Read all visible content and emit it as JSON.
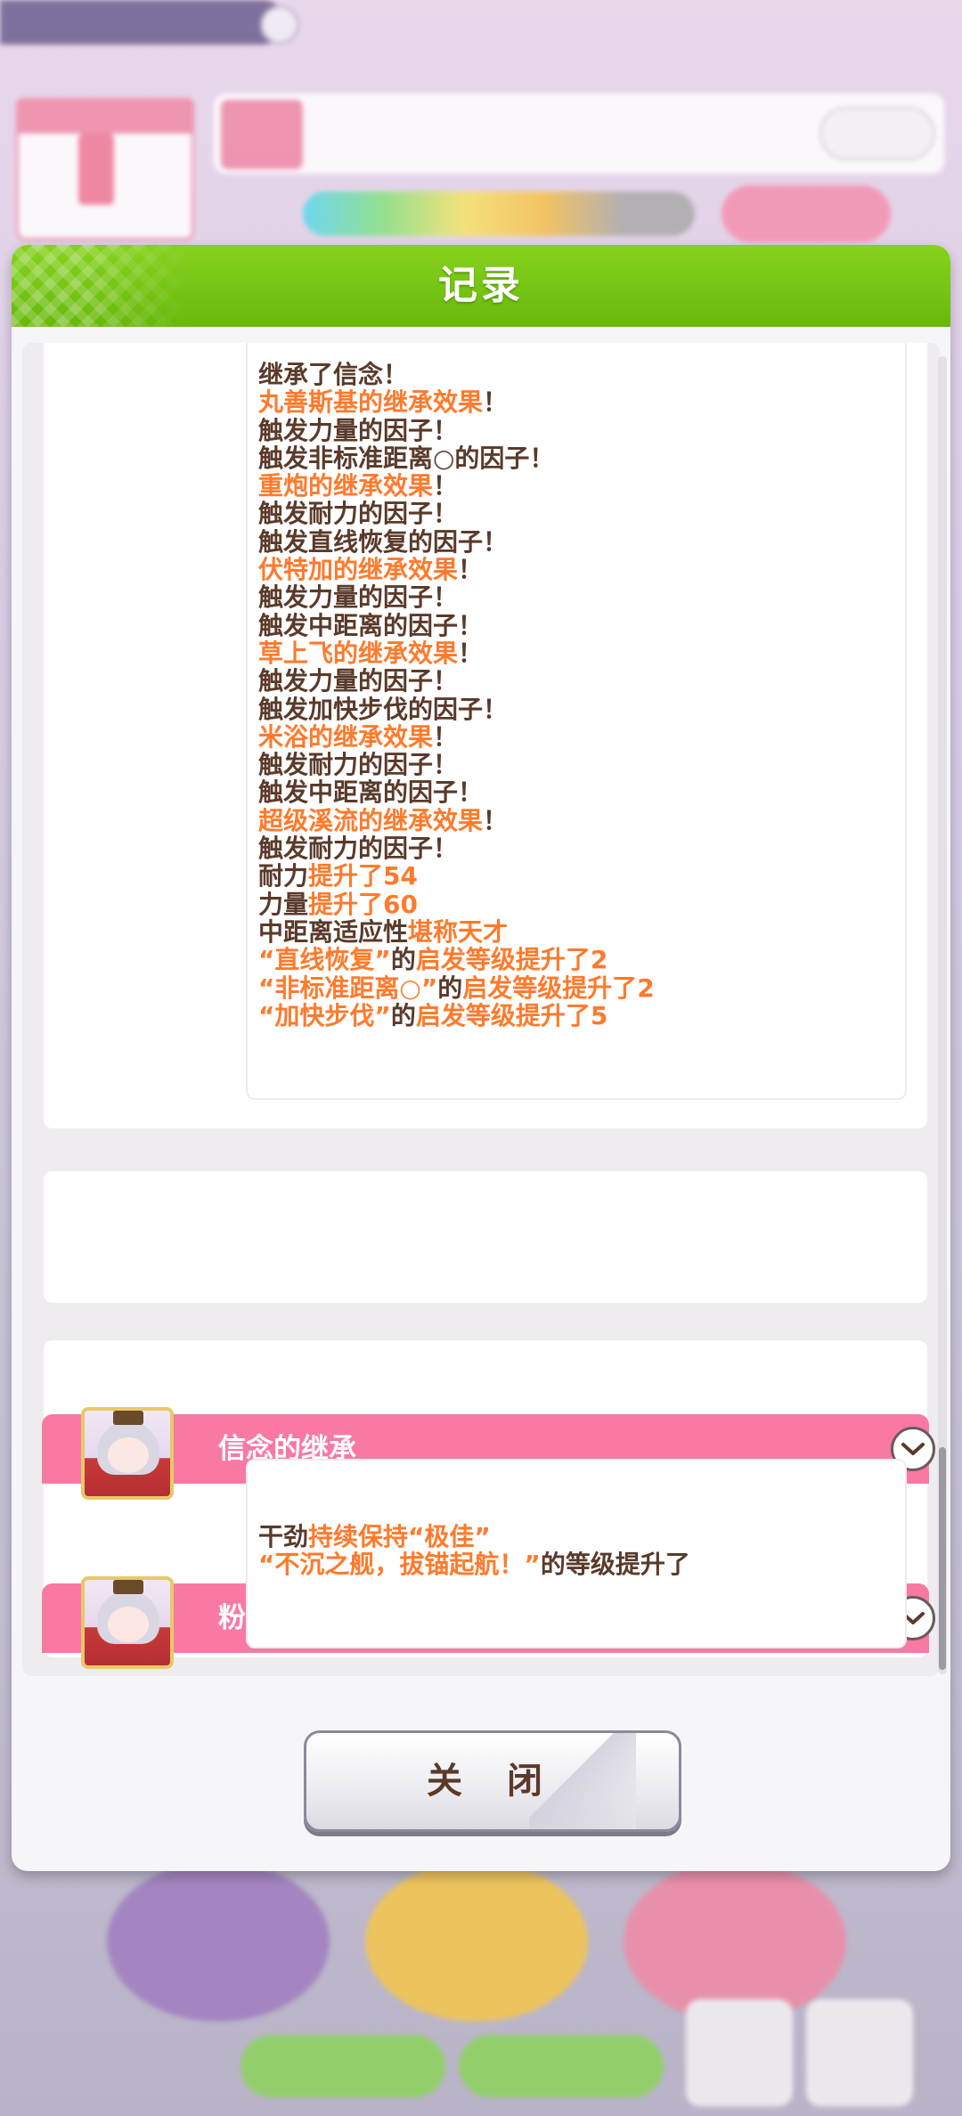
{
  "dialog": {
    "title": "记录",
    "close_label": "关 闭"
  },
  "log1": [
    [
      {
        "t": "继承了信念！",
        "c": "d"
      }
    ],
    [
      {
        "t": "丸善斯基的继承效果",
        "c": "o"
      },
      {
        "t": "！",
        "c": "d"
      }
    ],
    [
      {
        "t": "触发力量的因子！",
        "c": "d"
      }
    ],
    [
      {
        "t": "触发非标准距离○的因子！",
        "c": "d"
      }
    ],
    [
      {
        "t": "重炮的继承效果",
        "c": "o"
      },
      {
        "t": "！",
        "c": "d"
      }
    ],
    [
      {
        "t": "触发耐力的因子！",
        "c": "d"
      }
    ],
    [
      {
        "t": "触发直线恢复的因子！",
        "c": "d"
      }
    ],
    [
      {
        "t": "伏特加的继承效果",
        "c": "o"
      },
      {
        "t": "！",
        "c": "d"
      }
    ],
    [
      {
        "t": "触发力量的因子！",
        "c": "d"
      }
    ],
    [
      {
        "t": "触发中距离的因子！",
        "c": "d"
      }
    ],
    [
      {
        "t": "草上飞的继承效果",
        "c": "o"
      },
      {
        "t": "！",
        "c": "d"
      }
    ],
    [
      {
        "t": "触发力量的因子！",
        "c": "d"
      }
    ],
    [
      {
        "t": "触发加快步伐的因子！",
        "c": "d"
      }
    ],
    [
      {
        "t": "米浴的继承效果",
        "c": "o"
      },
      {
        "t": "！",
        "c": "d"
      }
    ],
    [
      {
        "t": "触发耐力的因子！",
        "c": "d"
      }
    ],
    [
      {
        "t": "触发中距离的因子！",
        "c": "d"
      }
    ],
    [
      {
        "t": "超级溪流的继承效果",
        "c": "o"
      },
      {
        "t": "！",
        "c": "d"
      }
    ],
    [
      {
        "t": "触发耐力的因子！",
        "c": "d"
      }
    ],
    [
      {
        "t": "耐力",
        "c": "d"
      },
      {
        "t": "提升了54",
        "c": "o"
      }
    ],
    [
      {
        "t": "力量",
        "c": "d"
      },
      {
        "t": "提升了60",
        "c": "o"
      }
    ],
    [
      {
        "t": "中距离适应性",
        "c": "d"
      },
      {
        "t": "堪称天才",
        "c": "o"
      }
    ],
    [
      {
        "t": "“直线恢复”",
        "c": "o"
      },
      {
        "t": "的",
        "c": "d"
      },
      {
        "t": "启发等级提升了2",
        "c": "o"
      }
    ],
    [
      {
        "t": "“非标准距离○”",
        "c": "o"
      },
      {
        "t": "的",
        "c": "d"
      },
      {
        "t": "启发等级提升了2",
        "c": "o"
      }
    ],
    [
      {
        "t": "“加快步伐”",
        "c": "o"
      },
      {
        "t": "的",
        "c": "d"
      },
      {
        "t": "启发等级提升了5",
        "c": "o"
      }
    ]
  ],
  "events": [
    {
      "title": "信念的继承"
    },
    {
      "title": "粉丝答谢会"
    }
  ],
  "log2": [
    [
      {
        "t": "干劲",
        "c": "d"
      },
      {
        "t": "持续保持“极佳”",
        "c": "o"
      }
    ],
    [
      {
        "t": "“不沉之舰，拔锚起航！”",
        "c": "o"
      },
      {
        "t": "的等级提升了",
        "c": "d"
      }
    ]
  ],
  "colors": {
    "header_green": "#78c816",
    "banner_pink": "#f879a2",
    "text_dark": "#5a3a2a",
    "text_orange": "#ff7a2c"
  },
  "icons": {
    "chevron": "chevron-down-icon",
    "avatar": "character-avatar"
  }
}
